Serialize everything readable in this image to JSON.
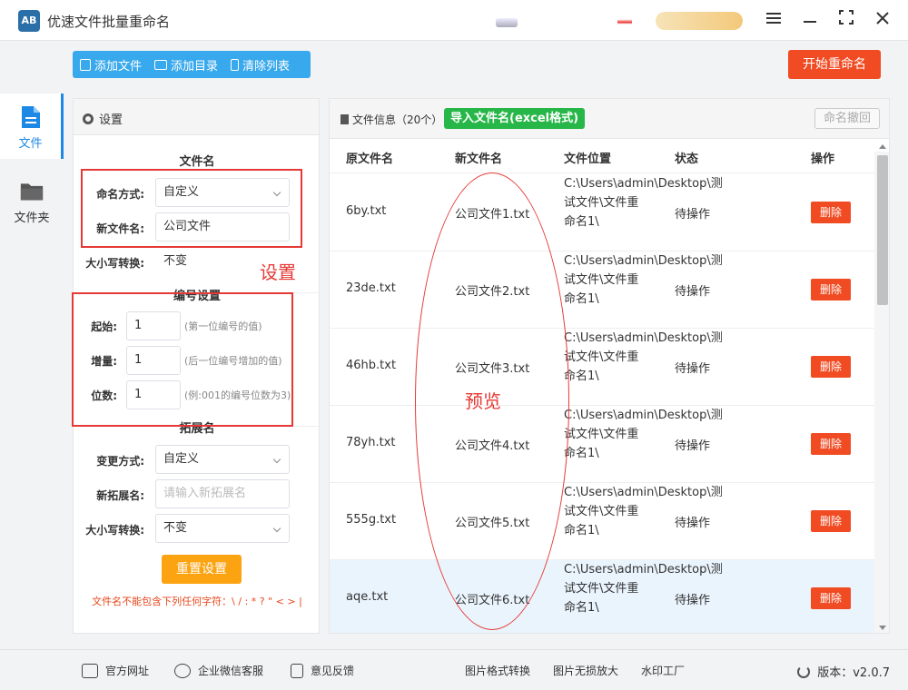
{
  "window": {
    "title": "优速文件批量重命名",
    "logo_text": "AB",
    "menu_icon": "hamburger-icon",
    "minimize_icon": "minimize-icon",
    "maximize_icon": "maximize-icon",
    "close_icon": "close-icon"
  },
  "leftnav": {
    "items": [
      {
        "label": "文件",
        "icon": "file-icon",
        "active": true
      },
      {
        "label": "文件夹",
        "icon": "folder-icon",
        "active": false
      }
    ]
  },
  "toolbar": {
    "add_file": "添加文件",
    "add_dir": "添加目录",
    "clear_list": "清除列表",
    "start_rename": "开始重命名"
  },
  "settings": {
    "title": "设置",
    "filename_section": "文件名",
    "naming_mode_label": "命名方式:",
    "naming_mode_value": "自定义",
    "new_name_label": "新文件名:",
    "new_name_value": "公司文件",
    "case_label": "大小写转换:",
    "case_value": "不变",
    "numbering_section": "编号设置",
    "start_label": "起始:",
    "start_value": "1",
    "start_hint": "(第一位编号的值)",
    "step_label": "增量:",
    "step_value": "1",
    "step_hint": "(后一位编号增加的值)",
    "digits_label": "位数:",
    "digits_value": "1",
    "digits_hint": "(例:001的编号位数为3)",
    "ext_section": "拓展名",
    "ext_mode_label": "变更方式:",
    "ext_mode_value": "自定义",
    "new_ext_label": "新拓展名:",
    "new_ext_placeholder": "请输入新拓展名",
    "ext_case_label": "大小写转换:",
    "ext_case_value": "不变",
    "reset_button": "重置设置",
    "warning": "文件名不能包含下列任何字符：\\ / : * ? \" < > |"
  },
  "annotations": {
    "settings_label": "设置",
    "preview_label": "预览",
    "color": "#e53935"
  },
  "files": {
    "title": "文件信息（20个）",
    "import_button": "导入文件名(excel格式)",
    "undo_button": "命名撤回",
    "columns": [
      "原文件名",
      "新文件名",
      "文件位置",
      "状态",
      "操作"
    ],
    "rows": [
      {
        "name": "6by.txt",
        "new_name": "公司文件1.txt",
        "path": "C:\\Users\\admin\\Desktop\\测试文件\\文件重命名1\\",
        "status": "待操作",
        "action": "删除"
      },
      {
        "name": "23de.txt",
        "new_name": "公司文件2.txt",
        "path": "C:\\Users\\admin\\Desktop\\测试文件\\文件重命名1\\",
        "status": "待操作",
        "action": "删除"
      },
      {
        "name": "46hb.txt",
        "new_name": "公司文件3.txt",
        "path": "C:\\Users\\admin\\Desktop\\测试文件\\文件重命名1\\",
        "status": "待操作",
        "action": "删除"
      },
      {
        "name": "78yh.txt",
        "new_name": "公司文件4.txt",
        "path": "C:\\Users\\admin\\Desktop\\测试文件\\文件重命名1\\",
        "status": "待操作",
        "action": "删除"
      },
      {
        "name": "555g.txt",
        "new_name": "公司文件5.txt",
        "path": "C:\\Users\\admin\\Desktop\\测试文件\\文件重命名1\\",
        "status": "待操作",
        "action": "删除"
      },
      {
        "name": "aqe.txt",
        "new_name": "公司文件6.txt",
        "path": "C:\\Users\\admin\\Desktop\\测试文件\\文件重命名1\\",
        "status": "待操作",
        "action": "删除"
      }
    ]
  },
  "footer": {
    "official_site": "官方网址",
    "wechat_service": "企业微信客服",
    "feedback": "意见反馈",
    "image_convert": "图片格式转换",
    "image_enlarge": "图片无损放大",
    "watermark": "水印工厂",
    "version": "版本：v2.0.7"
  }
}
